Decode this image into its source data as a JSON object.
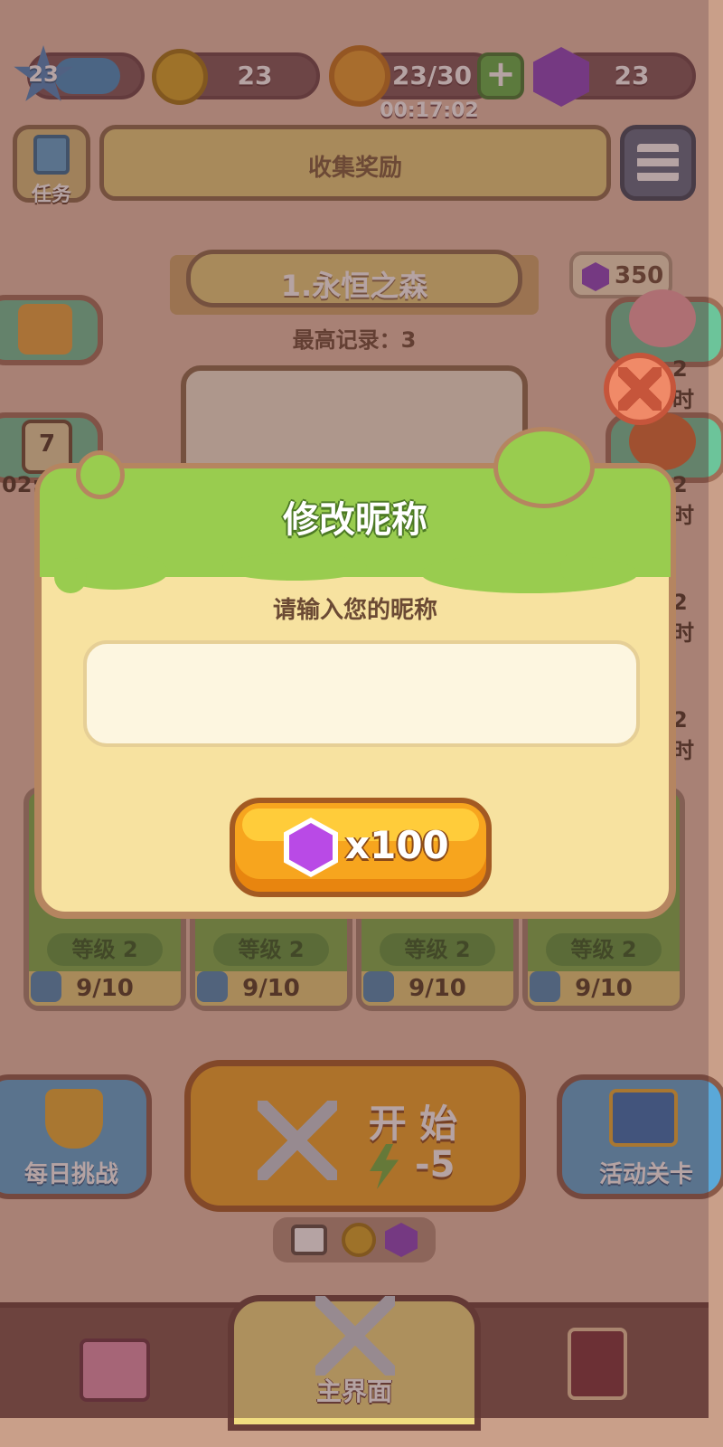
{
  "top_bar": {
    "level": "23",
    "xp_fill_percent": 60,
    "coins": "23",
    "energy": "23/30",
    "energy_timer": "00:17:02",
    "gems": "23"
  },
  "quest": {
    "label": "任务",
    "banner_text": "收集奖励"
  },
  "stage": {
    "title": "1.永恒之森",
    "best_record": "最高记录：3",
    "gem_reward": "350"
  },
  "left_side": {
    "calendar_day": "7",
    "timer_partial": "02:"
  },
  "right_side": {
    "timer_suffix": "2时"
  },
  "cards": [
    {
      "level": "等级 2",
      "progress": "9/10"
    },
    {
      "level": "等级 2",
      "progress": "9/10"
    },
    {
      "level": "等级 2",
      "progress": "9/10"
    },
    {
      "level": "等级 2",
      "progress": "9/10"
    }
  ],
  "actions": {
    "daily_challenge": "每日挑战",
    "start_label": "开 始",
    "start_cost": "-5",
    "event_level": "活动关卡"
  },
  "bottom_nav": {
    "main_label": "主界面"
  },
  "dialog": {
    "title": "修改昵称",
    "prompt": "请输入您的昵称",
    "input_value": "",
    "input_placeholder": "",
    "cost": "x100"
  },
  "colors": {
    "dialog_bg": "#f7e2a0",
    "dialog_header": "#99cc4f",
    "gem_purple": "#9b3fd6",
    "button_orange": "#f7a51e"
  }
}
